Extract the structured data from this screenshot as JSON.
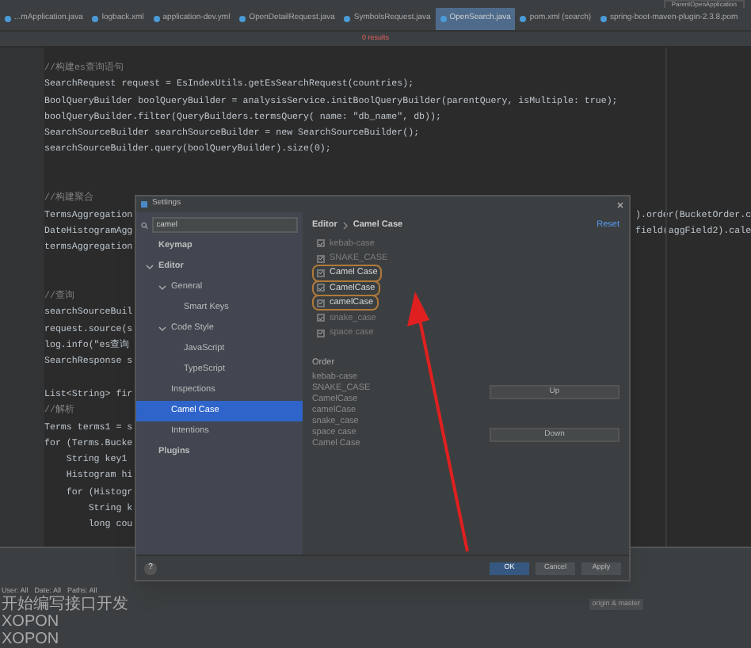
{
  "run_config": {
    "label": "ParentOpenApplication"
  },
  "tabs": [
    {
      "label": "...mApplication.java",
      "selected": false
    },
    {
      "label": "logback.xml",
      "selected": false
    },
    {
      "label": "application-dev.yml",
      "selected": false
    },
    {
      "label": "OpenDetailRequest.java",
      "selected": false
    },
    {
      "label": "SymbolsRequest.java",
      "selected": false
    },
    {
      "label": "OpenSearch.java",
      "selected": true
    },
    {
      "label": "pom.xml (search)",
      "selected": false
    },
    {
      "label": "spring-boot-maven-plugin-2.3.8.pom",
      "selected": false
    }
  ],
  "find_bar": {
    "results": "0 results"
  },
  "code_lines": [
    {
      "kind": "comment",
      "text": "//构建es查询语句"
    },
    {
      "kind": "code",
      "text": "SearchRequest request = EsIndexUtils.getEsSearchRequest(countries);"
    },
    {
      "kind": "code",
      "text": "BoolQueryBuilder boolQueryBuilder = analysisService.initBoolQueryBuilder(parentQuery, isMultiple: true);"
    },
    {
      "kind": "code",
      "text": "boolQueryBuilder.filter(QueryBuilders.termsQuery( name: \"db_name\", db));"
    },
    {
      "kind": "code",
      "text": "SearchSourceBuilder searchSourceBuilder = new SearchSourceBuilder();"
    },
    {
      "kind": "code",
      "text": "searchSourceBuilder.query(boolQueryBuilder).size(0);"
    },
    {
      "kind": "blank"
    },
    {
      "kind": "blank"
    },
    {
      "kind": "comment",
      "text": "//构建聚合"
    },
    {
      "kind": "code",
      "text": "TermsAggregation",
      "tail": ").order(BucketOrder.c"
    },
    {
      "kind": "code",
      "text": "DateHistogramAgg",
      "tail": "field(aggField2).cale"
    },
    {
      "kind": "code",
      "text": "termsAggregation"
    },
    {
      "kind": "blank"
    },
    {
      "kind": "blank"
    },
    {
      "kind": "comment",
      "text": "//查询"
    },
    {
      "kind": "code",
      "text": "searchSourceBuil"
    },
    {
      "kind": "code",
      "text": "request.source(s"
    },
    {
      "kind": "code",
      "text": "log.info(\"es查询"
    },
    {
      "kind": "code",
      "text": "SearchResponse s"
    },
    {
      "kind": "blank"
    },
    {
      "kind": "code",
      "text": "List<String> fir"
    },
    {
      "kind": "comment",
      "text": "//解析"
    },
    {
      "kind": "code",
      "text": "Terms terms1 = s"
    },
    {
      "kind": "code",
      "text": "for (Terms.Bucke"
    },
    {
      "kind": "code",
      "text": "    String key1"
    },
    {
      "kind": "code",
      "text": "    Histogram hi"
    },
    {
      "kind": "code",
      "text": "    for (Histogr"
    },
    {
      "kind": "code",
      "text": "        String k"
    },
    {
      "kind": "code",
      "text": "        long cou"
    }
  ],
  "dialog": {
    "title": "Settings",
    "search": {
      "value": "camel"
    },
    "tree": [
      {
        "label": "Keymap",
        "bold": true,
        "selected": false
      },
      {
        "label": "Editor",
        "bold": true,
        "selected": false,
        "expanded": true,
        "children": [
          {
            "label": "General",
            "bold": false,
            "selected": false,
            "expanded": true,
            "children": [
              {
                "label": "Smart Keys",
                "bold": false,
                "selected": false
              }
            ]
          },
          {
            "label": "Code Style",
            "bold": false,
            "selected": false,
            "expanded": true,
            "children": [
              {
                "label": "JavaScript",
                "bold": false,
                "selected": false
              },
              {
                "label": "TypeScript",
                "bold": false,
                "selected": false
              }
            ]
          },
          {
            "label": "Inspections",
            "bold": false,
            "selected": false
          },
          {
            "label": "Camel Case",
            "bold": false,
            "selected": true
          },
          {
            "label": "Intentions",
            "bold": false,
            "selected": false
          }
        ]
      },
      {
        "label": "Plugins",
        "bold": true,
        "selected": false
      }
    ],
    "breadcrumb": [
      "Editor",
      "Camel Case"
    ],
    "reset": "Reset",
    "options": [
      {
        "label": "kebab-case",
        "checked": true,
        "highlighted": false
      },
      {
        "label": "SNAKE_CASE",
        "checked": true,
        "highlighted": false
      },
      {
        "label": "Camel Case",
        "checked": true,
        "highlighted": true
      },
      {
        "label": "CamelCase",
        "checked": true,
        "highlighted": true
      },
      {
        "label": "camelCase",
        "checked": true,
        "highlighted": true
      },
      {
        "label": "snake_case",
        "checked": true,
        "highlighted": false
      },
      {
        "label": "space case",
        "checked": true,
        "highlighted": false
      }
    ],
    "order_label": "Order",
    "order": [
      "kebab-case",
      "SNAKE_CASE",
      "CamelCase",
      "camelCase",
      "snake_case",
      "space case",
      "Camel Case"
    ],
    "side_buttons": [
      "Up",
      "Down"
    ],
    "help": "?",
    "footer_buttons": [
      {
        "label": "OK",
        "primary": true
      },
      {
        "label": "Cancel",
        "primary": false
      },
      {
        "label": "Apply",
        "primary": false
      }
    ]
  },
  "log_panel": {
    "filters": [
      "User: All",
      "Date: All",
      "Paths: All"
    ],
    "commits": [
      "开始编写接口开发",
      "XOPON",
      "XOPON"
    ],
    "branch_tag": "origin & master"
  }
}
